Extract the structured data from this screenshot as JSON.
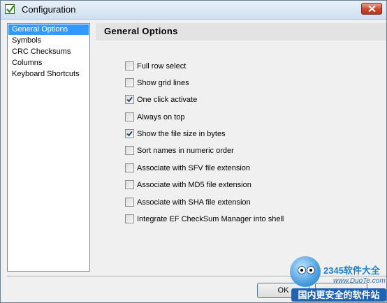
{
  "window": {
    "title": "Configuration",
    "icon": "checkmark-app-icon",
    "close_icon": "close-icon"
  },
  "sidebar": {
    "items": [
      {
        "label": "General Options",
        "selected": true
      },
      {
        "label": "Symbols",
        "selected": false
      },
      {
        "label": "CRC Checksums",
        "selected": false
      },
      {
        "label": "Columns",
        "selected": false
      },
      {
        "label": "Keyboard Shortcuts",
        "selected": false
      }
    ]
  },
  "panel": {
    "title": "General Options",
    "options": [
      {
        "label": "Full row select",
        "checked": false
      },
      {
        "label": "Show grid lines",
        "checked": false
      },
      {
        "label": "One click activate",
        "checked": true
      },
      {
        "label": "Always on top",
        "checked": false
      },
      {
        "label": "Show the file size in bytes",
        "checked": true
      },
      {
        "label": "Sort names in numeric order",
        "checked": false
      },
      {
        "label": "Associate with SFV file extension",
        "checked": false
      },
      {
        "label": "Associate with MD5 file extension",
        "checked": false
      },
      {
        "label": "Associate with SHA file extension",
        "checked": false
      },
      {
        "label": "Integrate EF CheckSum Manager into shell",
        "checked": false
      }
    ]
  },
  "footer": {
    "ok_label": "OK",
    "cancel_label": ""
  },
  "watermark": {
    "brand": "2345软件大全",
    "site": "www.DuoTe.com",
    "slogan": "国内更安全的软件站"
  },
  "colors": {
    "selection": "#3399ff",
    "panel_header": "#e3e3e3",
    "window_bg": "#f0f0f0"
  }
}
